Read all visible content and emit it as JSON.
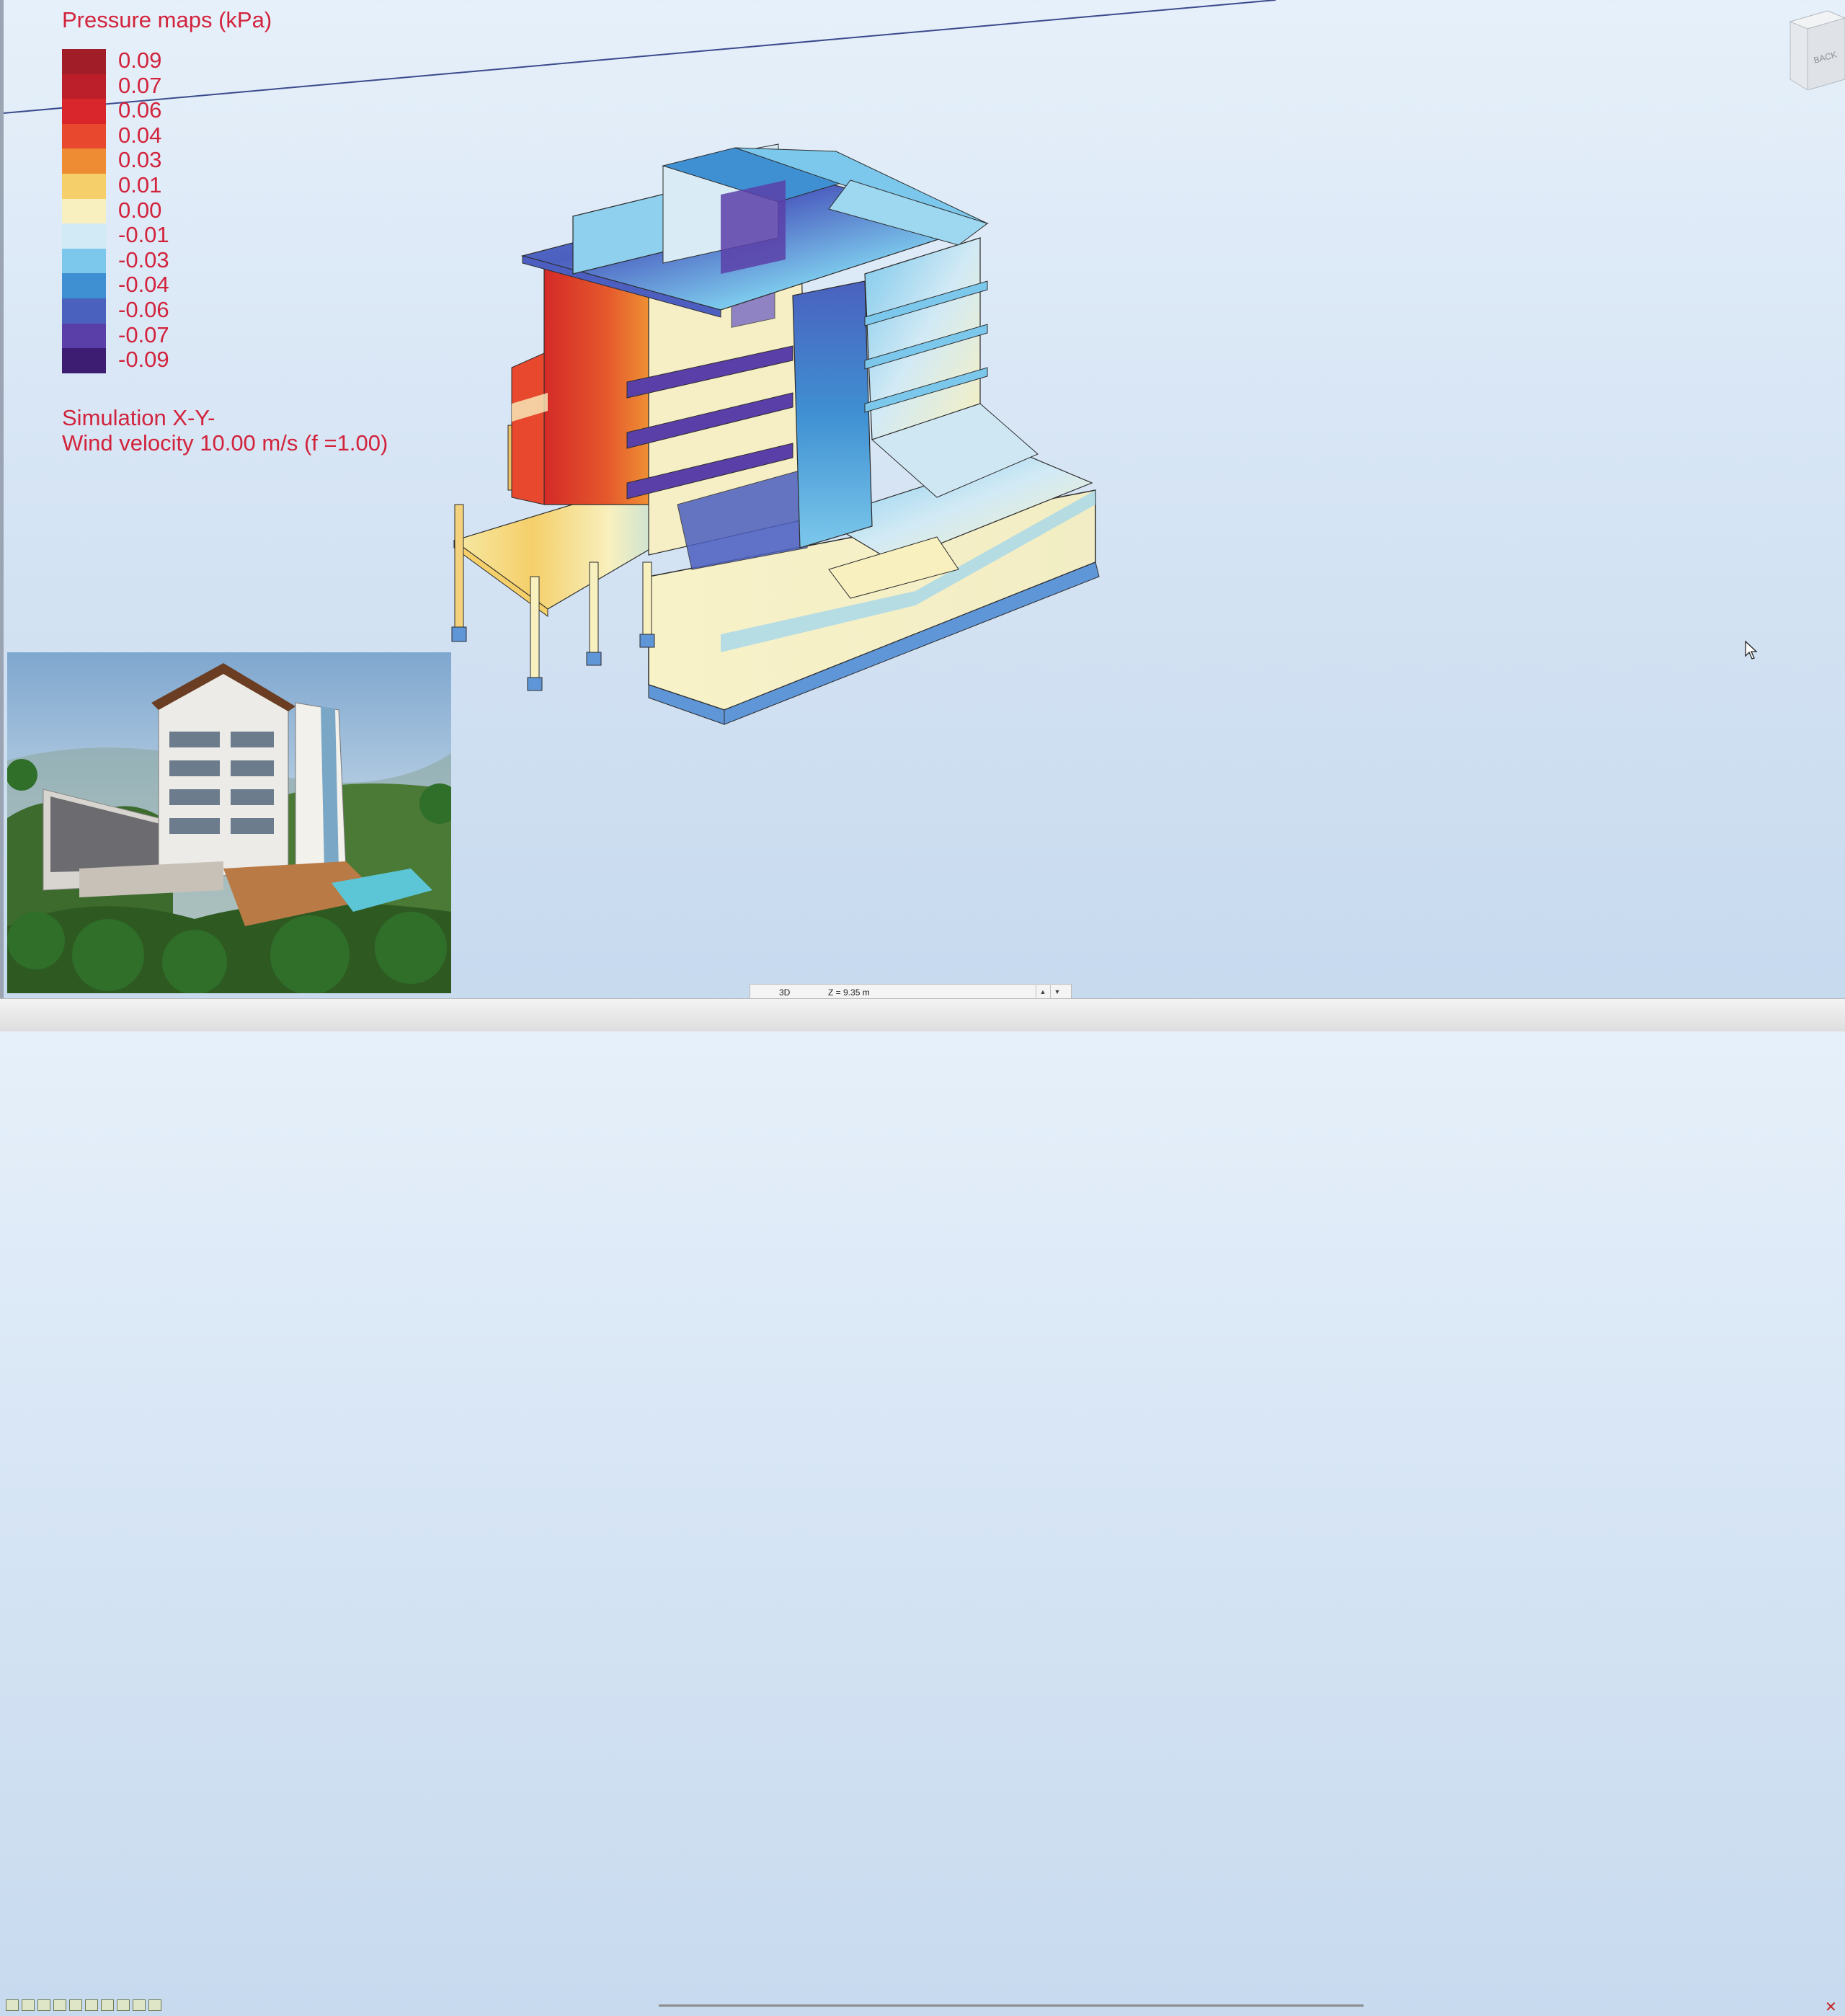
{
  "legend": {
    "title": "Pressure maps (kPa)",
    "entries": [
      {
        "label": "0.09",
        "color": "#a11d28"
      },
      {
        "label": "0.07",
        "color": "#bc1e2a"
      },
      {
        "label": "0.06",
        "color": "#d9262c"
      },
      {
        "label": "0.04",
        "color": "#e8482e"
      },
      {
        "label": "0.03",
        "color": "#ee8c34"
      },
      {
        "label": "0.01",
        "color": "#f5cf6a"
      },
      {
        "label": "0.00",
        "color": "#f8f0be"
      },
      {
        "label": "-0.01",
        "color": "#d2eaf5"
      },
      {
        "label": "-0.03",
        "color": "#7cc8ec"
      },
      {
        "label": "-0.04",
        "color": "#3f90d2"
      },
      {
        "label": "-0.06",
        "color": "#4a61be"
      },
      {
        "label": "-0.07",
        "color": "#5a3fa8"
      },
      {
        "label": "-0.09",
        "color": "#3d1d72"
      }
    ]
  },
  "simulation": {
    "label": "Simulation X-Y-",
    "velocity": "Wind velocity 10.00 m/s  (f =1.00)"
  },
  "viewcube": {
    "face_label": "BACK"
  },
  "statusbar": {
    "view_mode": "3D",
    "z_level": "Z = 9.35 m",
    "up_arrow": "▲",
    "down_arrow": "▼",
    "close_glyph": "✕"
  },
  "colors": {
    "legend_text": "#d2233c",
    "background_top": "#e6f0fa",
    "background_bottom": "#c6d9ee"
  }
}
